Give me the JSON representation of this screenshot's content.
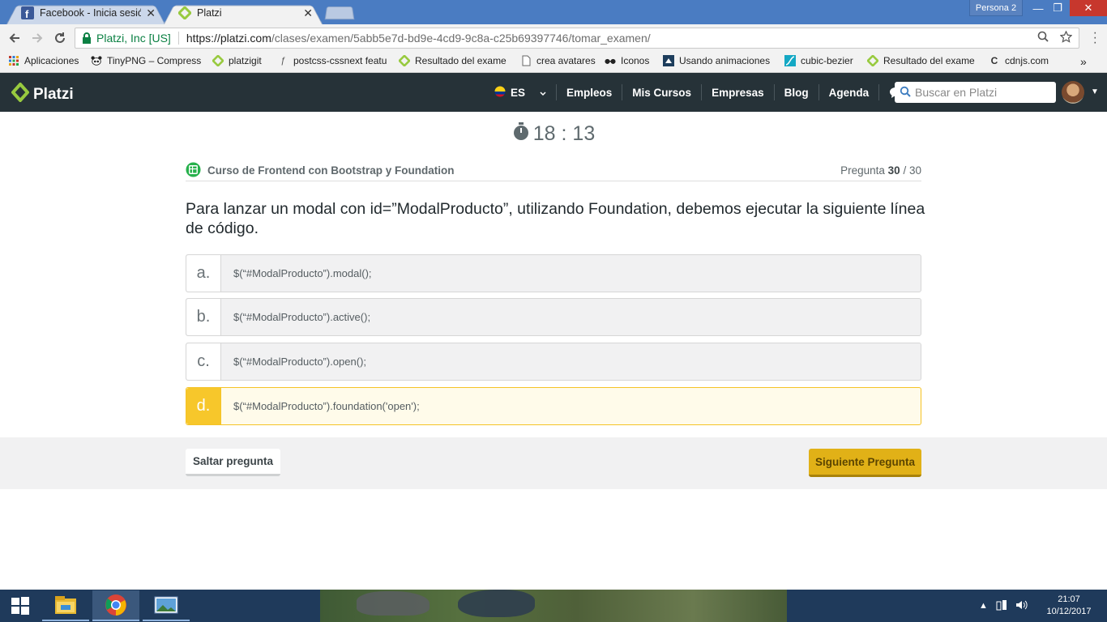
{
  "browser": {
    "tabs": [
      {
        "title": "Facebook - Inicia sesión o",
        "close": "✕"
      },
      {
        "title": "Platzi",
        "close": "✕"
      }
    ],
    "profile": "Persona 2",
    "window_controls": {
      "minimize": "—",
      "maximize": "❐",
      "close": "✕"
    },
    "address": {
      "site_identity": "Platzi, Inc [US]",
      "scheme_host": "https://platzi.com",
      "path": "/clases/examen/5abb5e7d-bd9e-4cd9-9c8a-c25b69397746/tomar_examen/"
    },
    "bookmarks": [
      {
        "label": "Aplicaciones",
        "icon": "apps-grid-icon"
      },
      {
        "label": "TinyPNG – Compress",
        "icon": "panda-icon"
      },
      {
        "label": "platzigit",
        "icon": "platzi-icon"
      },
      {
        "label": "postcss-cssnext featu",
        "icon": "postcss-icon"
      },
      {
        "label": "Resultado del exame",
        "icon": "platzi-icon"
      },
      {
        "label": "crea avatares",
        "icon": "page-icon"
      },
      {
        "label": "Iconos",
        "icon": "glasses-icon"
      },
      {
        "label": "Usando animaciones",
        "icon": "mdn-icon"
      },
      {
        "label": "cubic-bezier",
        "icon": "curve-icon"
      },
      {
        "label": "Resultado del exame",
        "icon": "platzi-icon"
      },
      {
        "label": "cdnjs.com",
        "icon": "cdnjs-icon"
      }
    ],
    "bookmarks_overflow": "»"
  },
  "platzi": {
    "logo_text": "Platzi",
    "language": "ES",
    "nav": [
      "Empleos",
      "Mis Cursos",
      "Empresas",
      "Blog",
      "Agenda"
    ],
    "search_placeholder": "Buscar en Platzi",
    "colors": {
      "header_bg": "#263238",
      "logo_green": "#98ca3f",
      "accent_yellow": "#f7c72b"
    }
  },
  "exam": {
    "timer": "18 : 13",
    "course": "Curso de Frontend con Bootstrap y Foundation",
    "question_label": "Pregunta",
    "question_current": "30",
    "question_total": "/ 30",
    "question_text": "Para lanzar un modal con id=”ModalProducto”, utilizando Foundation, debemos ejecutar la siguiente línea de código.",
    "answers": [
      {
        "letter": "a.",
        "text": "$(“#ModalProducto”).modal();",
        "selected": false
      },
      {
        "letter": "b.",
        "text": "$(“#ModalProducto”).active();",
        "selected": false
      },
      {
        "letter": "c.",
        "text": "$(“#ModalProducto”).open();",
        "selected": false
      },
      {
        "letter": "d.",
        "text": "$(“#ModalProducto”).foundation('open');",
        "selected": true
      }
    ],
    "skip_label": "Saltar pregunta",
    "next_label": "Siguiente Pregunta"
  },
  "taskbar": {
    "apps": [
      "file-explorer-icon",
      "chrome-icon",
      "photos-icon"
    ],
    "time": "21:07",
    "date": "10/12/2017"
  }
}
